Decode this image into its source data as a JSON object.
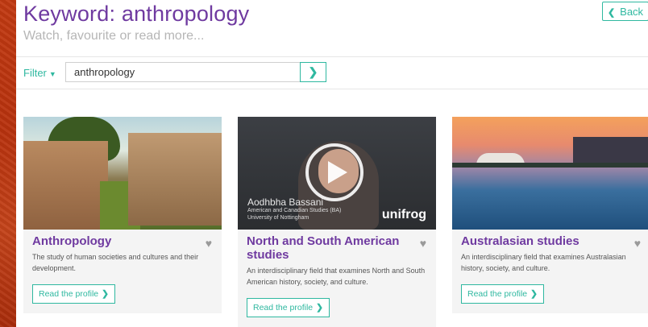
{
  "header": {
    "title": "Keyword: anthropology",
    "subtitle": "Watch, favourite or read more...",
    "back_label": "Back"
  },
  "search": {
    "filter_label": "Filter",
    "query": "anthropology"
  },
  "cards": [
    {
      "title": "Anthropology",
      "description": "The study of human societies and cultures and their development.",
      "button": "Read the profile"
    },
    {
      "title": "North and South American studies",
      "description": "An interdisciplinary field that examines North and South American history, society, and culture.",
      "button": "Read the profile",
      "video": {
        "presenter": "Aodhbha Bassani",
        "course": "American and Canadian Studies (BA)",
        "university": "University of Nottingham",
        "logo": "unifrog"
      }
    },
    {
      "title": "Australasian studies",
      "description": "An interdisciplinary field that examines Australasian history, society, and culture.",
      "button": "Read the profile"
    }
  ],
  "icons": {
    "back": "chevron-left-icon",
    "filter": "caret-down-icon",
    "search": "chevron-right-icon",
    "favourite": "heart-icon",
    "play": "play-icon"
  },
  "colors": {
    "brand_purple": "#6f3aa0",
    "accent_teal": "#2fb8a0",
    "card_bg": "#f4f4f4"
  }
}
